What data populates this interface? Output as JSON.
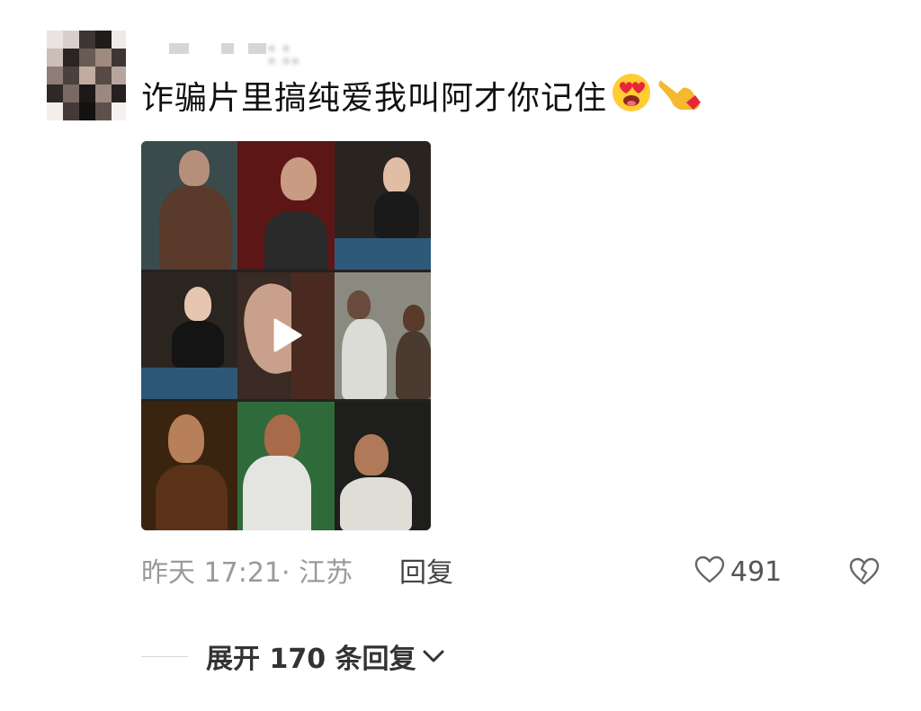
{
  "comment": {
    "avatar": {
      "icon": "avatar-pixelated"
    },
    "username": "▪ ▪ ▪.▪▪",
    "text": "诈骗片里搞纯爱我叫阿才你记住",
    "emojis": [
      "🥴",
      "👈"
    ],
    "video": {
      "icon": "play-icon"
    },
    "meta": {
      "time_location": "昨天 17:21· 江苏",
      "reply_label": "回复",
      "like_icon": "heart-outline-icon",
      "like_count": "491",
      "dislike_icon": "broken-heart-icon"
    },
    "expand": {
      "label": "展开 170 条回复",
      "icon": "chevron-down-icon"
    }
  }
}
